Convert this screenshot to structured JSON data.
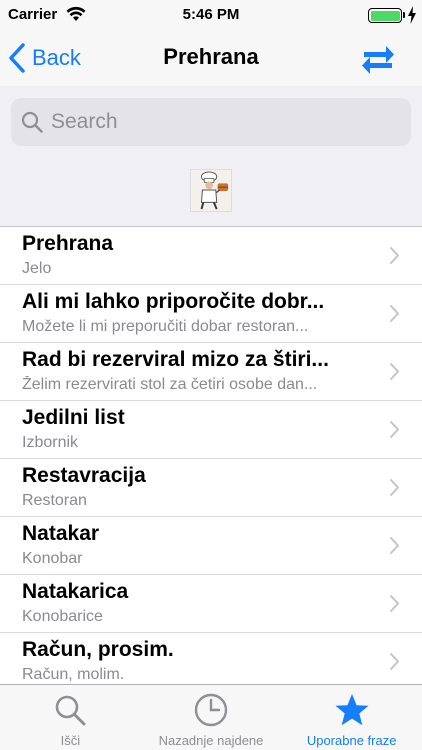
{
  "status_bar": {
    "carrier": "Carrier",
    "time": "5:46 PM"
  },
  "nav": {
    "back_label": "Back",
    "title": "Prehrana"
  },
  "search": {
    "placeholder": "Search"
  },
  "colors": {
    "accent": "#147efb",
    "battery": "#4cd964",
    "subtitle": "#8a8a8f",
    "tab_inactive": "#8e8e93"
  },
  "list": [
    {
      "title": "Prehrana",
      "subtitle": "Jelo"
    },
    {
      "title": "Ali mi lahko priporočite dobr...",
      "subtitle": "Možete li mi preporučiti dobar restoran..."
    },
    {
      "title": "Rad bi rezerviral mizo za štiri...",
      "subtitle": "Želim rezervirati stol za četiri osobe dan..."
    },
    {
      "title": "Jedilni list",
      "subtitle": "Izbornik"
    },
    {
      "title": "Restavracija",
      "subtitle": "Restoran"
    },
    {
      "title": "Natakar",
      "subtitle": "Konobar"
    },
    {
      "title": "Natakarica",
      "subtitle": "Konobarice"
    },
    {
      "title": "Račun, prosim.",
      "subtitle": "Račun, molim."
    }
  ],
  "tabs": [
    {
      "label": "Išči",
      "icon": "search-icon",
      "active": false
    },
    {
      "label": "Nazadnje najdene",
      "icon": "clock-icon",
      "active": false
    },
    {
      "label": "Uporabne fraze",
      "icon": "star-icon",
      "active": true
    }
  ]
}
